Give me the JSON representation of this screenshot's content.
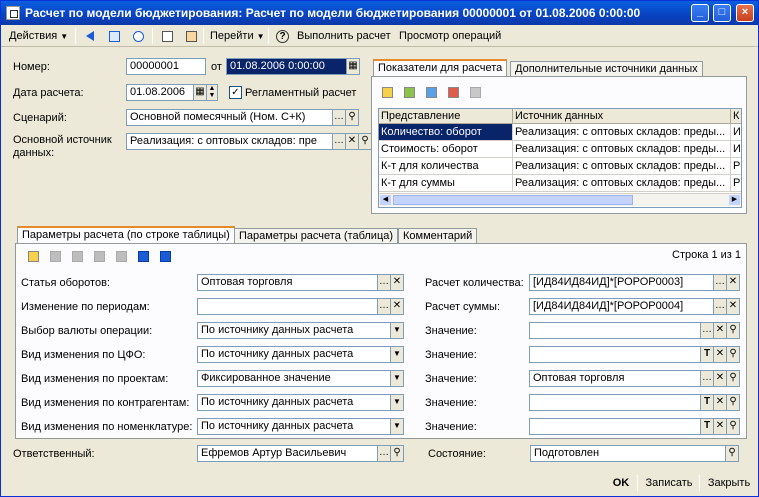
{
  "window": {
    "title": "Расчет по модели бюджетирования: Расчет по модели бюджетирования 00000001 от 01.08.2006 0:00:00",
    "minimize": "_",
    "maximize": "□",
    "close": "×"
  },
  "toolbar": {
    "actions": "Действия",
    "goto": "Перейти",
    "help": "?",
    "run_calc": "Выполнить расчет",
    "view_ops": "Просмотр операций"
  },
  "header": {
    "number_label": "Номер:",
    "number": "00000001",
    "from_label": "от",
    "date": "01.08.2006 0:00:00",
    "calc_date_label": "Дата расчета:",
    "calc_date": "01.08.2006",
    "regulated_label": "Регламентный расчет",
    "regulated_checked": "✓",
    "scenario_label": "Сценарий:",
    "scenario": "Основной помесячный (Ном. С+К)",
    "source_label": "Основной источник данных:",
    "source": "Реализация: с оптовых складов: пре"
  },
  "right_tabs": {
    "tab1": "Показатели для расчета",
    "tab2": "Дополнительные источники данных",
    "columns": [
      "Представление",
      "Источник данных",
      "К"
    ],
    "rows": [
      {
        "name": "Количество: оборот",
        "source": "Реализация: с оптовых складов: преды...",
        "k": "И"
      },
      {
        "name": "Стоимость: оборот",
        "source": "Реализация: с оптовых складов: преды...",
        "k": "И"
      },
      {
        "name": "К-т для количества",
        "source": "Реализация: с оптовых складов: преды...",
        "k": "Р"
      },
      {
        "name": "К-т для суммы",
        "source": "Реализация: с оптовых складов: преды...",
        "k": "Р"
      }
    ]
  },
  "bottom_tabs": {
    "tab1": "Параметры расчета (по строке таблицы)",
    "tab2": "Параметры расчета (таблица)",
    "tab3": "Комментарий",
    "row_counter": "Строка 1 из 1"
  },
  "params": {
    "left": [
      {
        "label": "Статья оборотов:",
        "value": "Оптовая торговля"
      },
      {
        "label": "Изменение по периодам:",
        "value": ""
      },
      {
        "label": "Выбор валюты операции:",
        "value": "По источнику данных расчета"
      },
      {
        "label": "Вид изменения по ЦФО:",
        "value": "По источнику данных расчета"
      },
      {
        "label": "Вид изменения по проектам:",
        "value": "Фиксированное значение"
      },
      {
        "label": "Вид изменения по контрагентам:",
        "value": "По источнику данных расчета"
      },
      {
        "label": "Вид изменения по номенклатуре:",
        "value": "По источнику данных расчета"
      }
    ],
    "right": [
      {
        "label": "Расчет количества:",
        "value": "[ИД84ИД84ИД]*[РОРОР0003]"
      },
      {
        "label": "Расчет суммы:",
        "value": "[ИД84ИД84ИД]*[РОРОР0004]"
      },
      {
        "label": "Значение:",
        "value": ""
      },
      {
        "label": "Значение:",
        "value": ""
      },
      {
        "label": "Значение:",
        "value": "Оптовая торговля"
      },
      {
        "label": "Значение:",
        "value": ""
      },
      {
        "label": "Значение:",
        "value": ""
      }
    ]
  },
  "footer": {
    "responsible_label": "Ответственный:",
    "responsible": "Ефремов Артур Васильевич",
    "state_label": "Состояние:",
    "state": "Подготовлен"
  },
  "buttons": {
    "ok": "OK",
    "save": "Записать",
    "close": "Закрыть"
  },
  "colors": {
    "title_bar": "#0842c0",
    "selection": "#0a246a",
    "background": "#ece9d8"
  }
}
